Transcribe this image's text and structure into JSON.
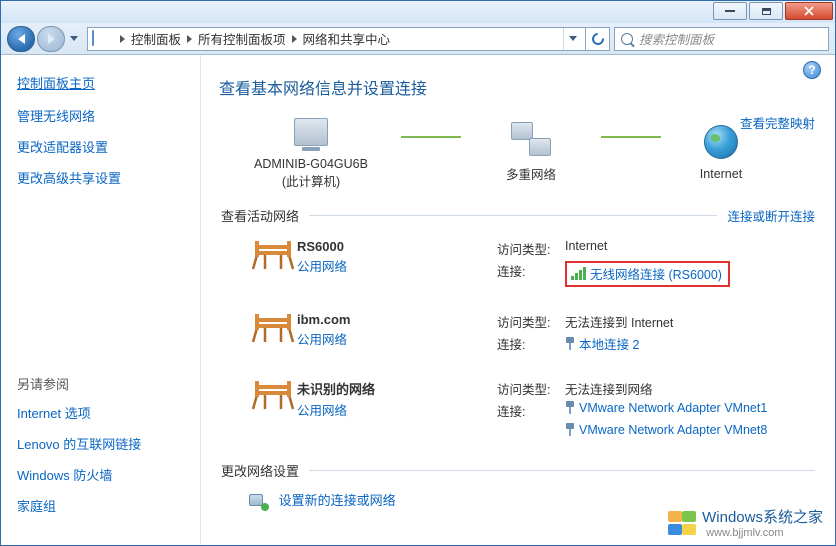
{
  "window": {
    "breadcrumbs": [
      "控制面板",
      "所有控制面板项",
      "网络和共享中心"
    ],
    "search_placeholder": "搜索控制面板"
  },
  "sidebar": {
    "title": "控制面板主页",
    "links": [
      "管理无线网络",
      "更改适配器设置",
      "更改高级共享设置"
    ],
    "see_also_title": "另请参阅",
    "see_also": [
      "Internet 选项",
      "Lenovo 的互联网链接",
      "Windows 防火墙",
      "家庭组"
    ]
  },
  "main": {
    "title": "查看基本网络信息并设置连接",
    "full_map_link": "查看完整映射",
    "map": {
      "computer": {
        "name": "ADMINIB-G04GU6B",
        "sub": "(此计算机)"
      },
      "middle": "多重网络",
      "internet": "Internet"
    },
    "active_header": "查看活动网络",
    "active_right_link": "连接或断开连接",
    "labels": {
      "access_type": "访问类型:",
      "connections": "连接:"
    },
    "networks": [
      {
        "name": "RS6000",
        "type": "公用网络",
        "access": "Internet",
        "connections": [
          {
            "icon": "signal",
            "label": "无线网络连接 (RS6000)",
            "highlight": true
          }
        ]
      },
      {
        "name": "ibm.com",
        "type": "公用网络",
        "access": "无法连接到 Internet",
        "connections": [
          {
            "icon": "plug",
            "label": "本地连接 2",
            "highlight": false
          }
        ]
      },
      {
        "name": "未识别的网络",
        "type": "公用网络",
        "access": "无法连接到网络",
        "connections": [
          {
            "icon": "plug",
            "label": "VMware Network Adapter VMnet1",
            "highlight": false
          },
          {
            "icon": "plug",
            "label": "VMware Network Adapter VMnet8",
            "highlight": false
          }
        ]
      }
    ],
    "change_settings_header": "更改网络设置",
    "new_connection_link": "设置新的连接或网络"
  },
  "watermark": {
    "brand": "Windows",
    "site": "系统之家",
    "url": "www.bjjmlv.com"
  }
}
